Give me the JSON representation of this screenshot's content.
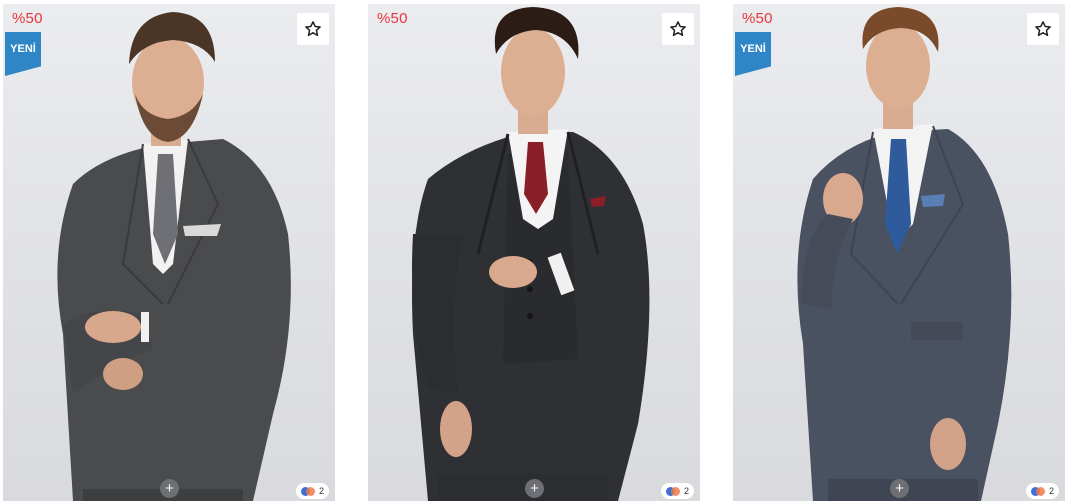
{
  "products": [
    {
      "discount": "%50",
      "badge": "YENİ",
      "color_count": "2",
      "suit_color": "#4a4b4d",
      "tie_color": "#6e7075",
      "hair_color": "#4a3526"
    },
    {
      "discount": "%50",
      "badge": "",
      "color_count": "2",
      "suit_color": "#2f3033",
      "tie_color": "#8b1f28",
      "hair_color": "#2b1d15"
    },
    {
      "discount": "%50",
      "badge": "YENİ",
      "color_count": "2",
      "suit_color": "#4a5160",
      "tie_color": "#2f5a9b",
      "hair_color": "#7a4a2a"
    }
  ],
  "icons": {
    "favorite": "star-outline-icon",
    "add": "plus-icon",
    "colors": "color-dots-icon"
  },
  "colors": {
    "discount": "#e8343c",
    "badge": "#2f86c6"
  }
}
